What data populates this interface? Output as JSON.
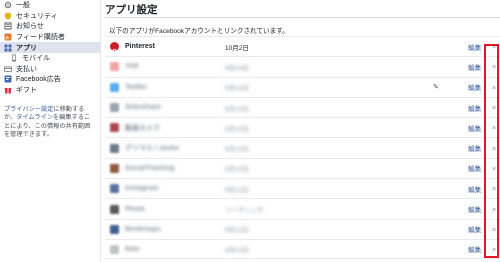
{
  "sidebar": {
    "items": [
      {
        "label": "一般",
        "icon": "gear-icon",
        "color": "#7f7f7f"
      },
      {
        "label": "セキュリティ",
        "icon": "shield-icon",
        "color": "#e9b200"
      },
      {
        "label": "お知らせ",
        "icon": "bell-icon",
        "color": "#4a4a4a"
      },
      {
        "label": "フィード購読者",
        "icon": "rss-icon",
        "color": "#e87a25"
      },
      {
        "label": "アプリ",
        "icon": "apps-icon",
        "color": "#4267b2",
        "active": true
      },
      {
        "label": "モバイル",
        "icon": "mobile-icon",
        "color": "#6d6d6d"
      },
      {
        "label": "支払い",
        "icon": "card-icon",
        "color": "#7f7f7f"
      },
      {
        "label": "Facebook広告",
        "icon": "ads-icon",
        "color": "#4267b2"
      },
      {
        "label": "ギフト",
        "icon": "gift-icon",
        "color": "#d8334a"
      }
    ],
    "note_parts": {
      "privacy_link": "プライバシー設定",
      "mid": "に移動するか、",
      "timeline_link": "タイムライン",
      "end": "を編集することにより、この情報の共有範囲を管理できます。"
    }
  },
  "main": {
    "title": "アプリ設定",
    "intro": "以下のアプリがFacebookアカウントとリンクされています。",
    "edit_label": "編集",
    "remove_label": "×",
    "apps": [
      {
        "name": "Pinterest",
        "date": "10月2日",
        "blurred": false,
        "icon_color": "#cb2027",
        "pencil": false
      },
      {
        "name": "YAK",
        "date": "6月14日",
        "blurred": true,
        "icon_color": "#f2a3a3",
        "pencil": false
      },
      {
        "name": "Twitter",
        "date": "6月14日",
        "blurred": true,
        "icon_color": "#55acee",
        "pencil": true
      },
      {
        "name": "SlideShare",
        "date": "6月13日",
        "blurred": true,
        "icon_color": "#9aa3ad",
        "pencil": false
      },
      {
        "name": "動画カメラ",
        "date": "6月13日",
        "blurred": true,
        "icon_color": "#b0464f",
        "pencil": false
      },
      {
        "name": "グリマル / Jaster",
        "date": "6月13日",
        "blurred": true,
        "icon_color": "#6d7a8c",
        "pencil": false
      },
      {
        "name": "SocialTracking",
        "date": "6月13日",
        "blurred": true,
        "icon_color": "#8f5b3e",
        "pencil": false
      },
      {
        "name": "Instagram",
        "date": "6月13日",
        "blurred": true,
        "icon_color": "#5b6f9b",
        "pencil": false
      },
      {
        "name": "Photo",
        "date": "リーディング",
        "blurred": true,
        "icon_color": "#5a5a5a",
        "pencil": false
      },
      {
        "name": "Bookmaps",
        "date": "6月13日",
        "blurred": true,
        "icon_color": "#3f5e8f",
        "pencil": false
      },
      {
        "name": "Nike",
        "date": "6月13日",
        "blurred": true,
        "icon_color": "#bfc3c8",
        "pencil": false
      }
    ]
  },
  "colors": {
    "highlight": "#e0162b",
    "link": "#365899",
    "active_bg": "#dfe3ee"
  }
}
